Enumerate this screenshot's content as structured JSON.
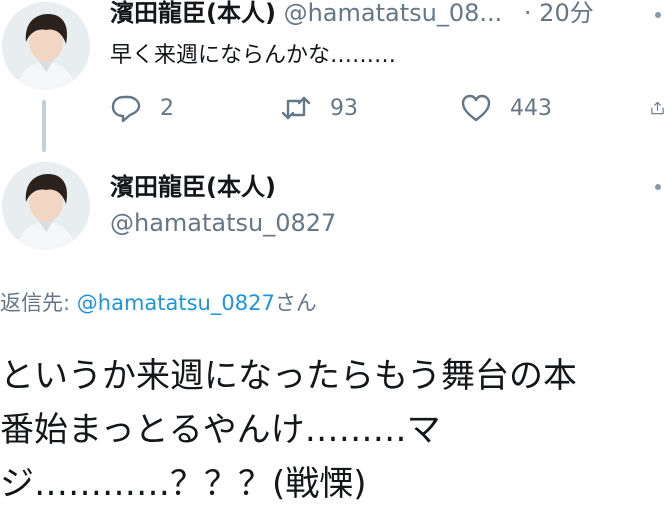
{
  "parent_tweet": {
    "display_name": "濱田龍臣(本人)",
    "handle": "@hamatatsu_08...",
    "separator": "·",
    "time": "20分",
    "text": "早く来週にならんかな………",
    "actions": {
      "reply_count": "2",
      "retweet_count": "93",
      "like_count": "443"
    }
  },
  "main_tweet": {
    "display_name": "濱田龍臣(本人)",
    "handle": "@hamatatsu_0827",
    "reply_to": {
      "prefix": "返信先: ",
      "mention": "@hamatatsu_0827",
      "suffix": "さん"
    },
    "text_lines": [
      "というか来週になったらもう舞台の本",
      "番始まっとるやんけ………マ",
      "ジ…………？？？(戦慄)"
    ]
  },
  "icons": {
    "reply": "speech-bubble-icon",
    "retweet": "retweet-arrows-icon",
    "like": "heart-icon",
    "share": "share-icon",
    "more": "more-options-icon"
  },
  "colors": {
    "text": "#14171a",
    "secondary": "#657786",
    "link": "#1b95e0",
    "thread_line": "#c4cfd6"
  }
}
